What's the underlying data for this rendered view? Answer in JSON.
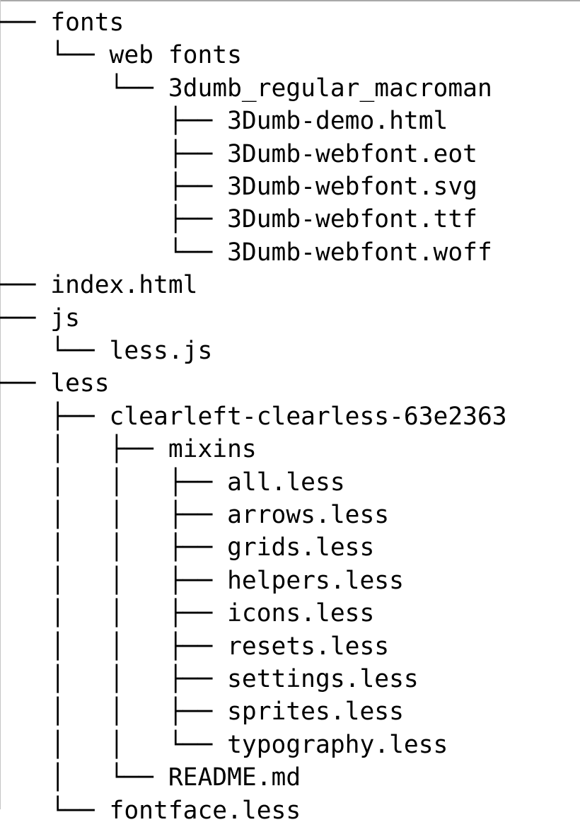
{
  "file_tree": {
    "entries": [
      {
        "prefix": "├── ",
        "name": "fonts",
        "icon": "folder-icon"
      },
      {
        "prefix": "│   └── ",
        "name": "web fonts",
        "icon": "folder-icon"
      },
      {
        "prefix": "│       └── ",
        "name": "3dumb_regular_macroman",
        "icon": "folder-icon"
      },
      {
        "prefix": "│           ├── ",
        "name": "3Dumb-demo.html",
        "icon": "file-icon"
      },
      {
        "prefix": "│           ├── ",
        "name": "3Dumb-webfont.eot",
        "icon": "file-icon"
      },
      {
        "prefix": "│           ├── ",
        "name": "3Dumb-webfont.svg",
        "icon": "file-icon"
      },
      {
        "prefix": "│           ├── ",
        "name": "3Dumb-webfont.ttf",
        "icon": "file-icon"
      },
      {
        "prefix": "│           └── ",
        "name": "3Dumb-webfont.woff",
        "icon": "file-icon"
      },
      {
        "prefix": "├── ",
        "name": "index.html",
        "icon": "file-icon"
      },
      {
        "prefix": "├── ",
        "name": "js",
        "icon": "folder-icon"
      },
      {
        "prefix": "│   └── ",
        "name": "less.js",
        "icon": "file-icon"
      },
      {
        "prefix": "└── ",
        "name": "less",
        "icon": "folder-icon"
      },
      {
        "prefix": "    ├── ",
        "name": "clearleft-clearless-63e2363",
        "icon": "folder-icon"
      },
      {
        "prefix": "    │   ├── ",
        "name": "mixins",
        "icon": "folder-icon"
      },
      {
        "prefix": "    │   │   ├── ",
        "name": "all.less",
        "icon": "file-icon"
      },
      {
        "prefix": "    │   │   ├── ",
        "name": "arrows.less",
        "icon": "file-icon"
      },
      {
        "prefix": "    │   │   ├── ",
        "name": "grids.less",
        "icon": "file-icon"
      },
      {
        "prefix": "    │   │   ├── ",
        "name": "helpers.less",
        "icon": "file-icon"
      },
      {
        "prefix": "    │   │   ├── ",
        "name": "icons.less",
        "icon": "file-icon"
      },
      {
        "prefix": "    │   │   ├── ",
        "name": "resets.less",
        "icon": "file-icon"
      },
      {
        "prefix": "    │   │   ├── ",
        "name": "settings.less",
        "icon": "file-icon"
      },
      {
        "prefix": "    │   │   ├── ",
        "name": "sprites.less",
        "icon": "file-icon"
      },
      {
        "prefix": "    │   │   └── ",
        "name": "typography.less",
        "icon": "file-icon"
      },
      {
        "prefix": "    │   └── ",
        "name": "README.md",
        "icon": "file-icon"
      },
      {
        "prefix": "    └── ",
        "name": "fontface.less",
        "icon": "file-icon"
      }
    ]
  }
}
